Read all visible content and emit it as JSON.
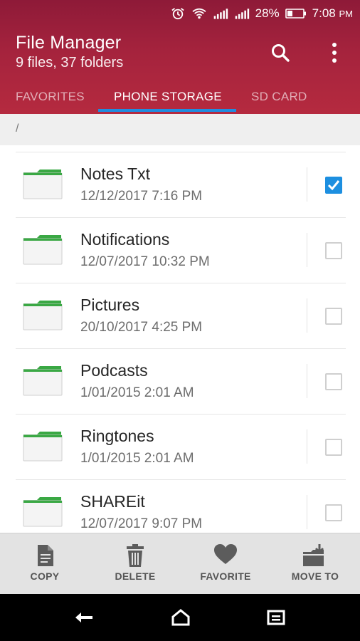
{
  "statusbar": {
    "battery": "28%",
    "time": "7:08",
    "ampm": "PM"
  },
  "header": {
    "title": "File Manager",
    "subtitle": "9 files, 37 folders"
  },
  "tabs": [
    {
      "label": "FAVORITES",
      "active": false
    },
    {
      "label": "PHONE STORAGE",
      "active": true
    },
    {
      "label": "SD CARD",
      "active": false
    }
  ],
  "breadcrumb": "/",
  "files": [
    {
      "name": "Notes Txt",
      "date": "12/12/2017 7:16 PM",
      "checked": true
    },
    {
      "name": "Notifications",
      "date": "12/07/2017 10:32 PM",
      "checked": false
    },
    {
      "name": "Pictures",
      "date": "20/10/2017 4:25 PM",
      "checked": false
    },
    {
      "name": "Podcasts",
      "date": "1/01/2015 2:01 AM",
      "checked": false
    },
    {
      "name": "Ringtones",
      "date": "1/01/2015 2:01 AM",
      "checked": false
    },
    {
      "name": "SHAREit",
      "date": "12/07/2017 9:07 PM",
      "checked": false
    }
  ],
  "actions": [
    {
      "label": "COPY",
      "icon": "copy-icon"
    },
    {
      "label": "DELETE",
      "icon": "trash-icon"
    },
    {
      "label": "FAVORITE",
      "icon": "heart-icon"
    },
    {
      "label": "MOVE TO",
      "icon": "move-folder-icon"
    }
  ],
  "colors": {
    "header": "#a5233d",
    "accent": "#1d8fe0",
    "folder": "#3aa844"
  }
}
